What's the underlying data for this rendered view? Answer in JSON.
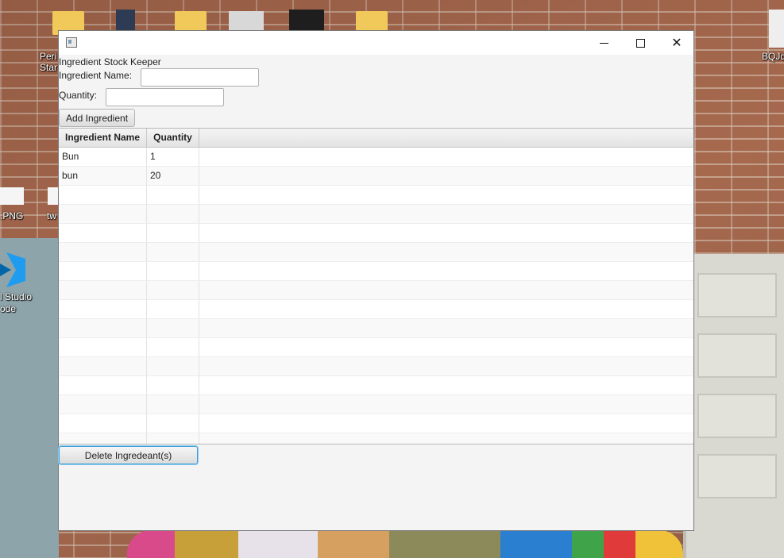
{
  "desktop": {
    "icons": [
      {
        "label": "Peri\nStar"
      },
      {
        "label": ".PNG"
      },
      {
        "label": "tw"
      },
      {
        "label": "l Studio\node"
      },
      {
        "label": "BQJq"
      }
    ]
  },
  "window": {
    "title": "",
    "app_title_label": "Ingredient Stock Keeper",
    "name_label": "Ingredient Name:",
    "name_value": "",
    "quantity_label": "Quantity:",
    "quantity_value": "",
    "add_button": "Add Ingredient",
    "delete_button": "Delete Ingredeant(s)",
    "table": {
      "columns": [
        "Ingredient Name",
        "Quantity"
      ],
      "rows": [
        {
          "name": "Bun",
          "quantity": "1"
        },
        {
          "name": "bun",
          "quantity": "20"
        }
      ],
      "empty_rows": 14
    }
  },
  "colors": {
    "focus_accent": "#3f9ed6",
    "window_bg": "#f4f4f4"
  }
}
